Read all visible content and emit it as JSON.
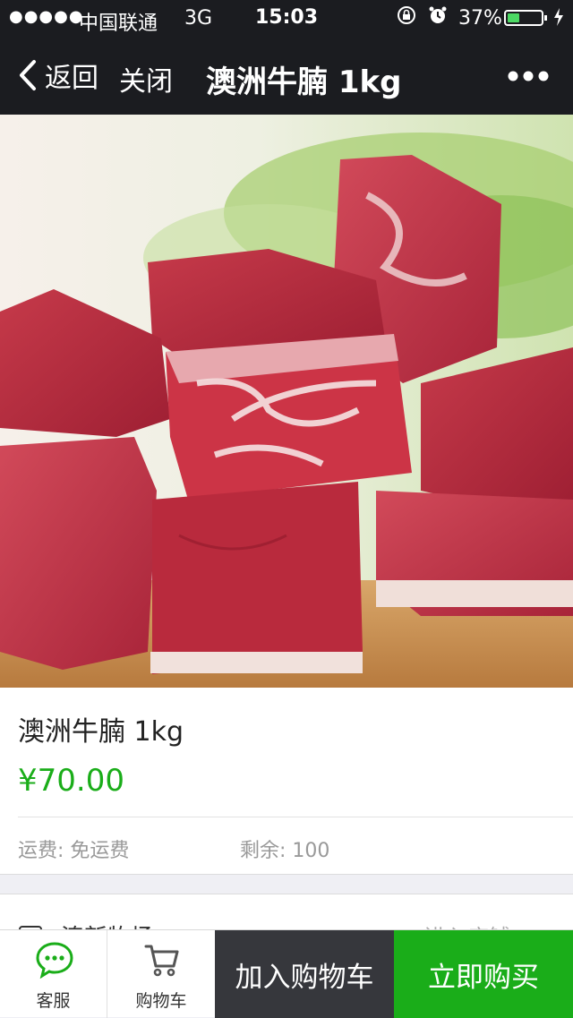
{
  "status_bar": {
    "signal": "●●●●●",
    "carrier": "中国联通",
    "network": "3G",
    "time": "15:03",
    "battery_percent": "37%",
    "battery_level": 0.37,
    "icons": [
      "signal-icon",
      "lock-rotation-icon",
      "alarm-icon",
      "battery-icon",
      "charging-icon"
    ]
  },
  "navbar": {
    "back_label": "返回",
    "close_label": "关闭",
    "title": "澳洲牛腩 1kg",
    "more_icon": "more-icon"
  },
  "product": {
    "image_icon": "beef-cubes-photo",
    "name": "澳洲牛腩 1kg",
    "price": "¥70.00",
    "shipping": "运费: 免运费",
    "stock": "剩余: 100"
  },
  "store": {
    "name": "澳新牧场",
    "enter_label": "进入店铺 >"
  },
  "bottom_bar": {
    "service_label": "客服",
    "cart_label": "购物车",
    "add_to_cart": "加入购物车",
    "buy_now": "立即购买"
  },
  "colors": {
    "nav_bg": "#1b1c20",
    "price_green": "#1aad19",
    "buy_green": "#1aad19",
    "cart_dark": "#36373c",
    "battery_green": "#4cd964"
  }
}
